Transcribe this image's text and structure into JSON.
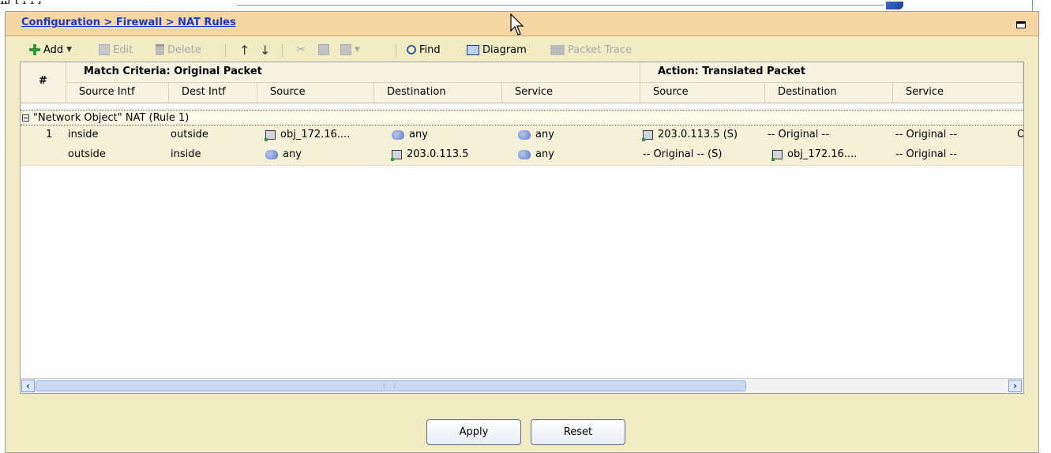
{
  "breadcrumb": "Configuration > Firewall > NAT Rules",
  "toolbar": {
    "add": "Add",
    "edit": "Edit",
    "delete": "Delete",
    "find": "Find",
    "diagram": "Diagram",
    "packet_trace": "Packet Trace"
  },
  "table": {
    "hash_header": "#",
    "group_match": "Match Criteria: Original Packet",
    "group_action": "Action: Translated Packet",
    "columns": [
      "Source Intf",
      "Dest Intf",
      "Source",
      "Destination",
      "Service",
      "Source",
      "Destination",
      "Service"
    ],
    "section_label": "\"Network Object\" NAT (Rule 1)",
    "rows": [
      {
        "num": "1",
        "source_intf": "inside",
        "dest_intf": "outside",
        "source": "obj_172.16....",
        "destination": "any",
        "service": "any",
        "t_source": "203.0.113.5 (S)",
        "t_destination": "-- Original --",
        "t_service": "-- Original --",
        "overflow": "O"
      },
      {
        "num": "",
        "source_intf": "outside",
        "dest_intf": "inside",
        "source": "any",
        "destination": "203.0.113.5",
        "service": "any",
        "t_source": "-- Original -- (S)",
        "t_destination": "obj_172.16....",
        "t_service": "-- Original --",
        "overflow": ""
      }
    ]
  },
  "buttons": {
    "apply": "Apply",
    "reset": "Reset"
  },
  "icons": {
    "add": "plus-icon",
    "edit": "edit-icon",
    "delete": "trash-icon",
    "move_up": "arrow-up-icon",
    "move_down": "arrow-down-icon",
    "cut": "scissors-icon",
    "copy": "copy-icon",
    "paste": "paste-icon",
    "find": "magnifier-icon",
    "diagram": "diagram-icon",
    "packet_trace": "packet-trace-icon",
    "host_object": "host-icon",
    "network_any": "network-icon"
  },
  "colors": {
    "title_bar": "#f6d7a4",
    "panel_bg": "#f1ecc4",
    "breadcrumb_link": "#1a39c2",
    "row_bg": "#f5f1d8",
    "add_green": "#2c9a3a"
  }
}
